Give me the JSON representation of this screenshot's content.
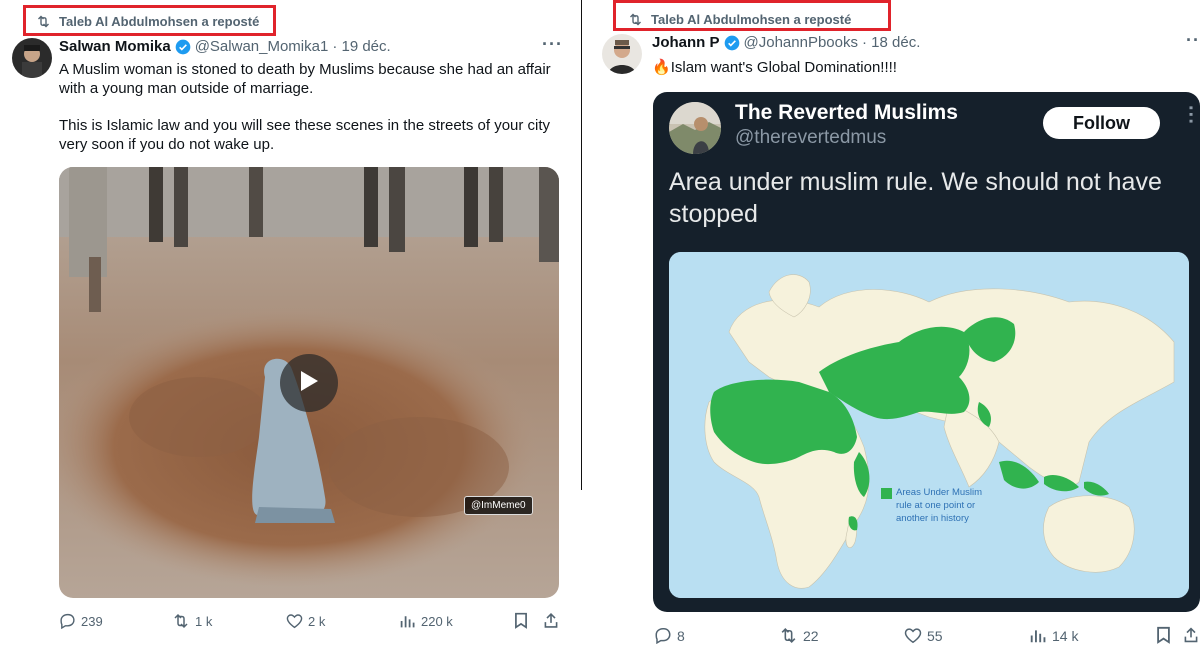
{
  "colors": {
    "highlight_box": "#e0232b",
    "verified_blue": "#1d9bf0",
    "secondary_text": "#536471",
    "dark_card": "#15202b",
    "map_water": "#b9dff2",
    "map_land": "#f6f2dc",
    "map_muslim_rule": "#31b34f"
  },
  "left_post": {
    "repost_label": "Taleb Al Abdulmohsen a reposté",
    "author_name": "Salwan Momika",
    "author_handle": "@Salwan_Momika1",
    "date": "· 19 déc.",
    "paragraph_1": "A Muslim woman is stoned to death by Muslims because she had an affair with a young man outside of marriage.",
    "paragraph_2": "This is Islamic law and you will see these scenes in the streets of your city very soon if you do not wake up.",
    "video_watermark": "@ImMeme0",
    "icons": [
      "repost-icon",
      "verified-icon",
      "more-icon",
      "play-icon",
      "reply-icon",
      "retweet-icon",
      "like-icon",
      "views-icon",
      "bookmark-icon",
      "share-icon"
    ],
    "stats": {
      "replies": "239",
      "reposts": "1 k",
      "likes": "2 k",
      "views": "220 k"
    }
  },
  "right_post": {
    "repost_label": "Taleb Al Abdulmohsen a reposté",
    "author_name": "Johann P",
    "author_handle": "@JohannPbooks",
    "date": "· 18 déc.",
    "text": "Islam want's Global Domination!!!!",
    "emoji": "🔥",
    "quote": {
      "author_name": "The Reverted Muslims",
      "author_handle": "@therevertedmus",
      "follow_label": "Follow",
      "text": "Area under muslim rule. We should not have stopped",
      "map_legend": [
        "Areas Under Muslim",
        "rule at one point or",
        "another in history"
      ]
    },
    "stats": {
      "replies": "8",
      "reposts": "22",
      "likes": "55",
      "views": "14 k"
    }
  }
}
